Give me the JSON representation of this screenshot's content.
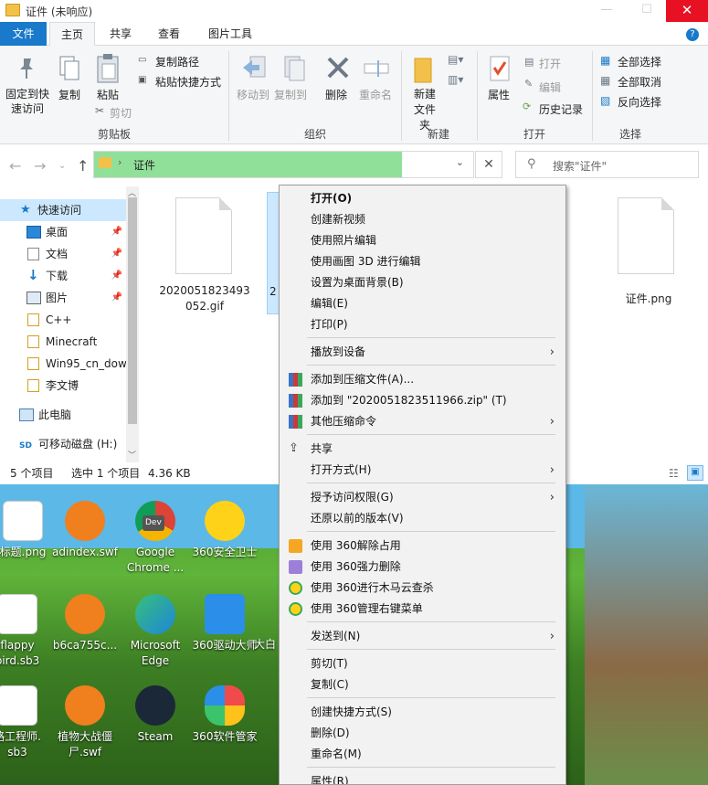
{
  "window": {
    "title": "证件 (未响应)",
    "minimize": "—",
    "maximize": "☐",
    "close": "✕"
  },
  "tabs": {
    "file": "文件",
    "home": "主页",
    "share": "共享",
    "view": "查看",
    "picture_tools": "图片工具",
    "help": "?"
  },
  "ribbon": {
    "pin_quick": "固定到快速访问",
    "copy": "复制",
    "paste": "粘贴",
    "copy_path": "复制路径",
    "paste_shortcut": "粘贴快捷方式",
    "cut": "剪切",
    "clipboard": "剪贴板",
    "move_to": "移动到",
    "copy_to": "复制到",
    "delete": "删除",
    "rename": "重命名",
    "organize": "组织",
    "new_folder": "新建文件夹",
    "new": "新建",
    "properties": "属性",
    "open": "打开",
    "edit": "编辑",
    "history": "历史记录",
    "open_group": "打开",
    "select_all": "全部选择",
    "select_none": "全部取消",
    "invert_select": "反向选择",
    "select": "选择"
  },
  "address": {
    "path": "证件",
    "search_placeholder": "搜索\"证件\""
  },
  "nav": {
    "items": [
      {
        "label": "快速访问",
        "icon": "star-icon"
      },
      {
        "label": "桌面",
        "icon": "desktop-icon"
      },
      {
        "label": "文档",
        "icon": "document-icon"
      },
      {
        "label": "下载",
        "icon": "download-icon"
      },
      {
        "label": "图片",
        "icon": "picture-icon"
      },
      {
        "label": "C++",
        "icon": "folder-icon"
      },
      {
        "label": "Minecraft",
        "icon": "folder-icon"
      },
      {
        "label": "Win95_cn_dow",
        "icon": "folder-icon"
      },
      {
        "label": "李文博",
        "icon": "folder-icon"
      },
      {
        "label": "此电脑",
        "icon": "computer-icon"
      },
      {
        "label": "可移动磁盘 (H:)",
        "icon": "sd-card-icon"
      }
    ]
  },
  "files": {
    "items": [
      {
        "line1": "2020051823493",
        "line2": "052.gif"
      },
      {
        "line1": "2",
        "line2": ""
      },
      {
        "line1": "证件.png",
        "line2": ""
      }
    ]
  },
  "status": {
    "count": "5 个项目",
    "selected": "选中 1 个项目",
    "size": "4.36 KB"
  },
  "desktop": {
    "icons": [
      {
        "line1": "标题.png",
        "line2": ""
      },
      {
        "line1": "adindex.swf",
        "line2": ""
      },
      {
        "line1": "Google",
        "line2": "Chrome ..."
      },
      {
        "line1": "360安全卫士",
        "line2": ""
      },
      {
        "line1": "flappy",
        "line2": "bird.sb3"
      },
      {
        "line1": "b6ca755c...",
        "line2": ""
      },
      {
        "line1": "Microsoft",
        "line2": "Edge"
      },
      {
        "line1": "360驱动大师",
        "line2": ""
      },
      {
        "line1": "路工程师.",
        "line2": "sb3"
      },
      {
        "line1": "植物大战僵",
        "line2": "尸.swf"
      },
      {
        "line1": "Steam",
        "line2": ""
      },
      {
        "line1": "360软件管家",
        "line2": ""
      }
    ],
    "partial": "大白",
    "chrome_badge": "Dev"
  },
  "menu": {
    "open": "打开(O)",
    "new_video": "创建新视频",
    "photos_edit": "使用照片编辑",
    "paint3d": "使用画图 3D 进行编辑",
    "set_wallpaper": "设置为桌面背景(B)",
    "edit": "编辑(E)",
    "print": "打印(P)",
    "cast": "播放到设备",
    "add_archive": "添加到压缩文件(A)...",
    "add_zip": "添加到 \"2020051823511966.zip\" (T)",
    "other_compress": "其他压缩命令",
    "share": "共享",
    "open_with": "打开方式(H)",
    "grant_access": "授予访问权限(G)",
    "restore": "还原以前的版本(V)",
    "unlock360": "使用 360解除占用",
    "forcedelete360": "使用 360强力删除",
    "trojan360": "使用 360进行木马云查杀",
    "menu360": "使用 360管理右键菜单",
    "send_to": "发送到(N)",
    "cut": "剪切(T)",
    "copy": "复制(C)",
    "shortcut": "创建快捷方式(S)",
    "delete": "删除(D)",
    "rename": "重命名(M)",
    "properties": "属性(R)"
  },
  "colors": {
    "accent": "#1979ca",
    "address_bg": "#90e09a",
    "close_red": "#e81123"
  }
}
